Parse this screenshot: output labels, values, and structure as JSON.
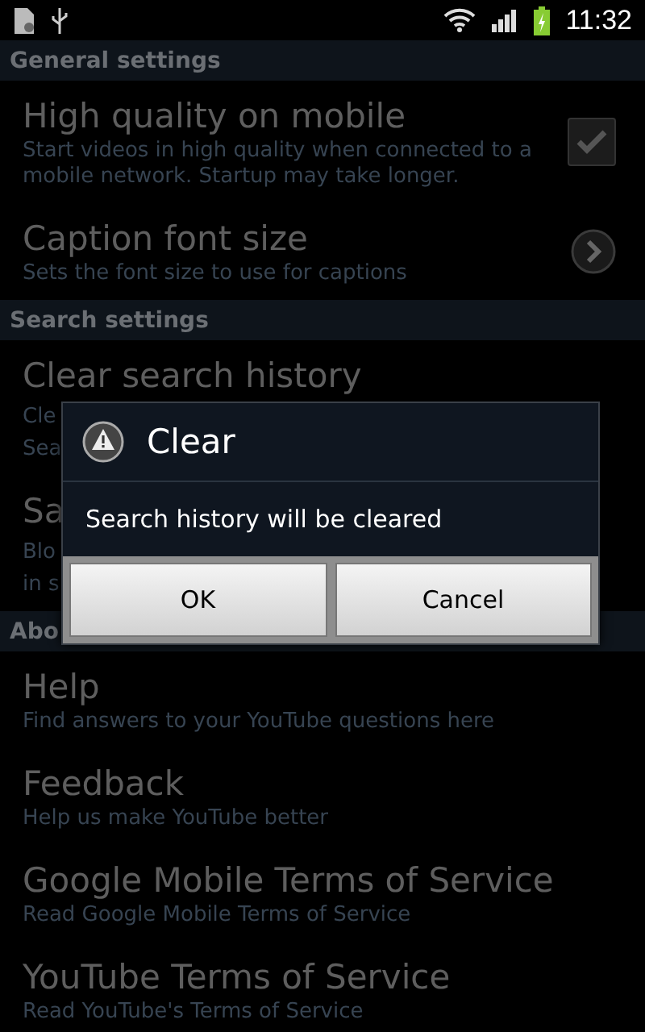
{
  "status_bar": {
    "time": "11:32"
  },
  "sections": [
    {
      "header": "General settings",
      "items": [
        {
          "title": "High quality on mobile",
          "summary": "Start videos in high quality when connected to a mobile network. Startup may take longer.",
          "kind": "checkbox",
          "checked": true
        },
        {
          "title": "Caption font size",
          "summary": "Sets the font size to use for captions",
          "kind": "chevron"
        }
      ]
    },
    {
      "header": "Search settings",
      "items": [
        {
          "title": "Clear search history",
          "summary_fragments": [
            "Cle",
            "Sea"
          ],
          "kind": "plain"
        },
        {
          "title": "Sa",
          "summary_fragments": [
            "Blo",
            "in s"
          ],
          "kind": "plain"
        }
      ]
    },
    {
      "header": "Abo",
      "items": [
        {
          "title": "Help",
          "summary": "Find answers to your YouTube questions here",
          "kind": "plain"
        },
        {
          "title": "Feedback",
          "summary": "Help us make YouTube better",
          "kind": "plain"
        },
        {
          "title": "Google Mobile Terms of Service",
          "summary": "Read Google Mobile Terms of Service",
          "kind": "plain"
        },
        {
          "title": "YouTube Terms of Service",
          "summary": "Read YouTube's Terms of Service",
          "kind": "plain"
        }
      ]
    }
  ],
  "dialog": {
    "title": "Clear",
    "message": "Search history will be cleared",
    "buttons": [
      "OK",
      "Cancel"
    ]
  }
}
